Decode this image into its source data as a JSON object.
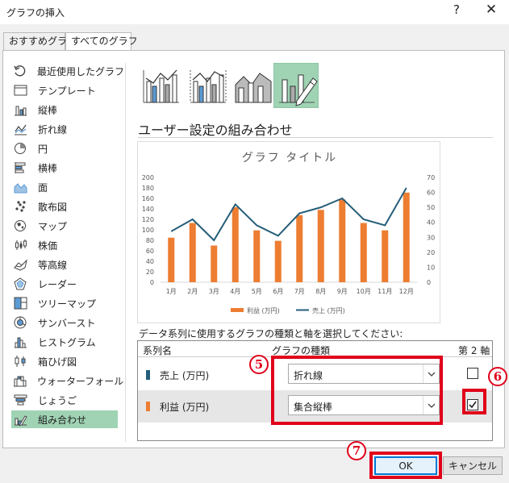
{
  "dialog": {
    "title": "グラフの挿入",
    "help": "?",
    "close": "✕"
  },
  "tabs": [
    "おすすめグラフ",
    "すべてのグラフ"
  ],
  "sidebar": {
    "items": [
      {
        "label": "最近使用したグラフ",
        "icon": "recent-icon"
      },
      {
        "label": "テンプレート",
        "icon": "template-icon"
      },
      {
        "label": "縦棒",
        "icon": "column-chart-icon"
      },
      {
        "label": "折れ線",
        "icon": "line-chart-icon"
      },
      {
        "label": "円",
        "icon": "pie-chart-icon"
      },
      {
        "label": "横棒",
        "icon": "bar-chart-icon"
      },
      {
        "label": "面",
        "icon": "area-chart-icon"
      },
      {
        "label": "散布図",
        "icon": "scatter-chart-icon"
      },
      {
        "label": "マップ",
        "icon": "map-chart-icon"
      },
      {
        "label": "株価",
        "icon": "stock-chart-icon"
      },
      {
        "label": "等高線",
        "icon": "surface-chart-icon"
      },
      {
        "label": "レーダー",
        "icon": "radar-chart-icon"
      },
      {
        "label": "ツリーマップ",
        "icon": "treemap-chart-icon"
      },
      {
        "label": "サンバースト",
        "icon": "sunburst-chart-icon"
      },
      {
        "label": "ヒストグラム",
        "icon": "histogram-chart-icon"
      },
      {
        "label": "箱ひげ図",
        "icon": "boxwhisker-chart-icon"
      },
      {
        "label": "ウォーターフォール",
        "icon": "waterfall-chart-icon"
      },
      {
        "label": "じょうご",
        "icon": "funnel-chart-icon"
      },
      {
        "label": "組み合わせ",
        "icon": "combo-chart-icon"
      }
    ],
    "selected_index": 18
  },
  "combo_heading": "ユーザー設定の組み合わせ",
  "instruction": "データ系列に使用するグラフの種類と軸を選択してください:",
  "grid": {
    "headers": [
      "系列名",
      "グラフの種類",
      "第 2 軸"
    ],
    "rows": [
      {
        "name": "売上 (万円)",
        "type": "折れ線",
        "secondary": false,
        "color": "#255e79"
      },
      {
        "name": "利益 (万円)",
        "type": "集合縦棒",
        "secondary": true,
        "color": "#ed7d31"
      }
    ]
  },
  "annotations": {
    "m5": "5",
    "m6": "6",
    "m7": "7"
  },
  "buttons": {
    "ok": "OK",
    "cancel": "キャンセル"
  },
  "colors": {
    "accent_selected": "#9fd3b4",
    "bar": "#ed7d31",
    "line": "#255e79",
    "highlight": "#e0001a"
  },
  "chart_data": {
    "type": "bar",
    "title": "グラフ タイトル",
    "categories": [
      "1月",
      "2月",
      "3月",
      "4月",
      "5月",
      "6月",
      "7月",
      "8月",
      "9月",
      "10月",
      "11月",
      "12月"
    ],
    "series": [
      {
        "name": "利益 (万円)",
        "type": "bar",
        "axis": "left",
        "values": [
          85,
          113,
          70,
          143,
          99,
          79,
          128,
          138,
          158,
          113,
          99,
          171
        ]
      },
      {
        "name": "売上 (万円)",
        "type": "line",
        "axis": "right",
        "values": [
          34,
          42,
          28,
          52,
          38,
          31,
          46,
          50,
          56,
          42,
          38,
          63
        ]
      }
    ],
    "ylim_left": [
      0,
      200
    ],
    "yticks_left": [
      "0",
      "20",
      "40",
      "60",
      "80",
      "100",
      "120",
      "140",
      "160",
      "180",
      "200"
    ],
    "ylim_right": [
      0,
      70
    ],
    "yticks_right": [
      "0",
      "10",
      "20",
      "30",
      "40",
      "50",
      "60",
      "70"
    ],
    "legend": "bottom",
    "grid": false
  }
}
